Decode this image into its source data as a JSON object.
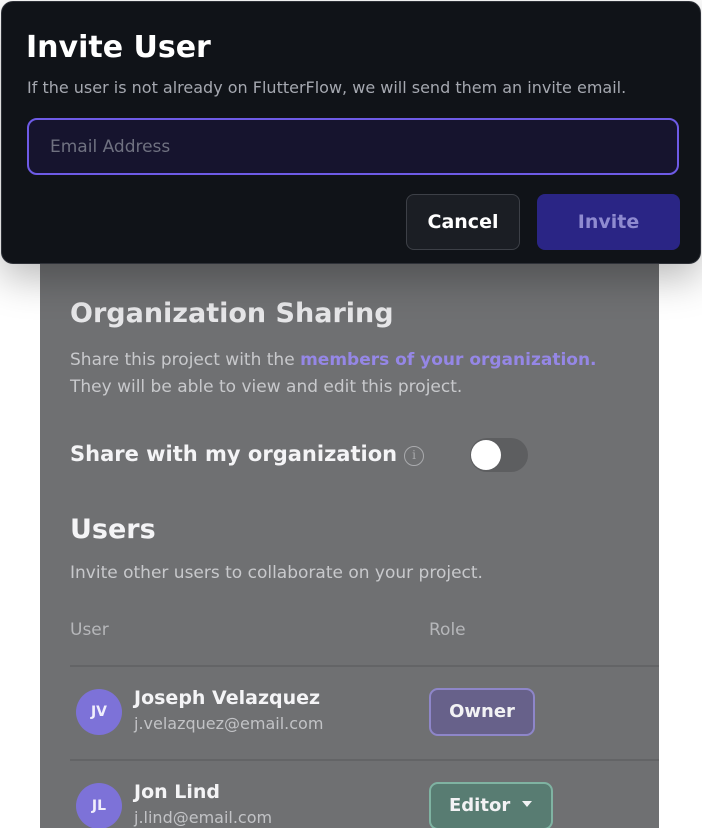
{
  "modal": {
    "title": "Invite User",
    "subtitle": "If the user is not already on FlutterFlow, we will send them an invite email.",
    "email_placeholder": "Email Address",
    "email_value": "",
    "cancel_label": "Cancel",
    "invite_label": "Invite"
  },
  "org_sharing": {
    "title": "Organization Sharing",
    "desc_prefix": "Share this project with the ",
    "desc_link": "members of your organization.",
    "desc_line2": "They will be able to view and edit this project.",
    "toggle_label": "Share with my organization",
    "info_icon": "info-icon",
    "toggle_on": false
  },
  "users": {
    "title": "Users",
    "desc": "Invite other users to collaborate on your project.",
    "col_user": "User",
    "col_role": "Role",
    "rows": [
      {
        "initials": "JV",
        "name": "Joseph Velazquez",
        "email": "j.velazquez@email.com",
        "role": "Owner"
      },
      {
        "initials": "JL",
        "name": "Jon Lind",
        "email": "j.lind@email.com",
        "role": "Editor"
      }
    ]
  },
  "colors": {
    "accent": "#6e5be6",
    "link": "#9587e6",
    "avatar": "#7d72d8",
    "owner_badge": "#8e86c9",
    "editor_badge": "#7fb3a2"
  }
}
